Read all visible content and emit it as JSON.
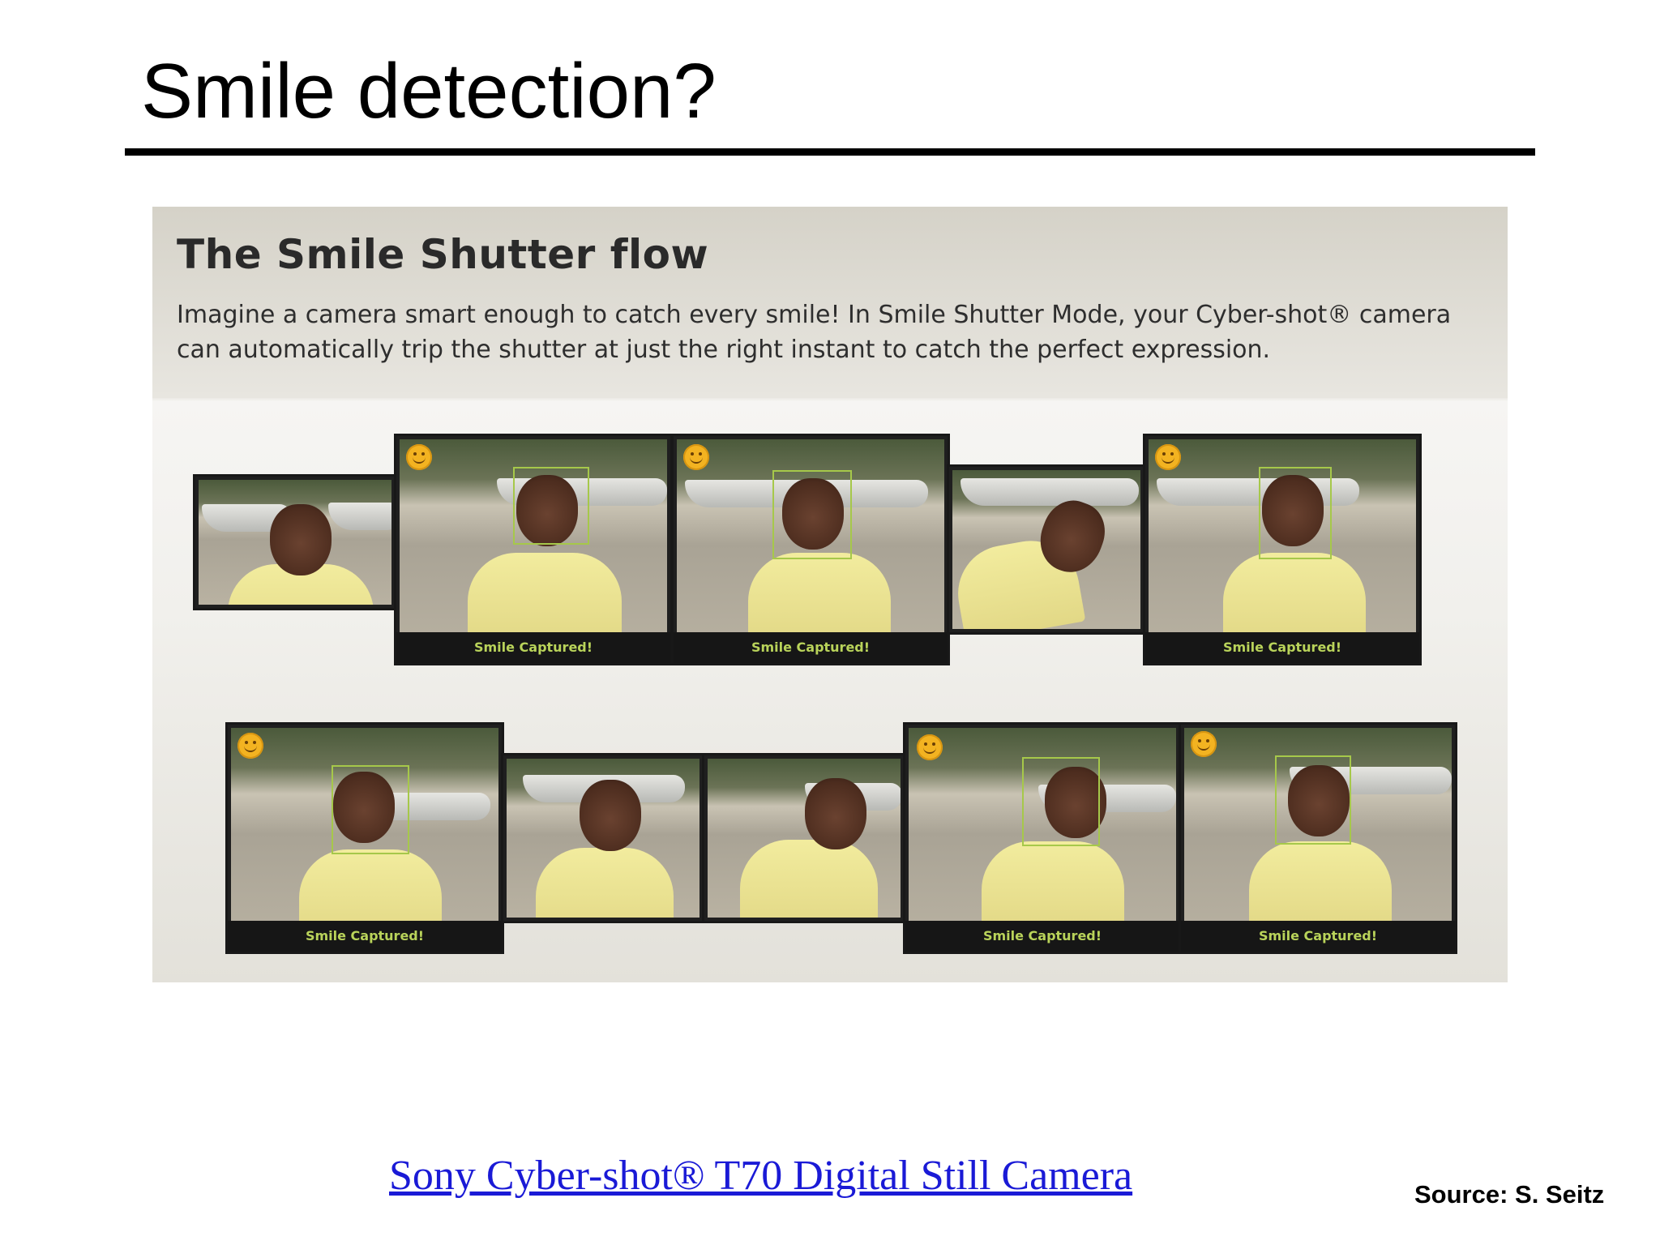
{
  "slide": {
    "title": "Smile detection?",
    "source_link": "Sony Cyber-shot® T70 Digital Still Camera ",
    "source_credit": "Source: S. Seitz"
  },
  "panel": {
    "title": "The Smile Shutter flow",
    "description": "Imagine a camera smart enough to catch every smile! In Smile Shutter Mode, your Cyber-shot® camera can automatically trip the shutter at just the right instant to catch the perfect expression."
  },
  "frames": {
    "caption": "Smile Captured!"
  },
  "colors": {
    "link": "#1a1ad6",
    "focus_box": "#a6c84a",
    "caption_text": "#b9d35a",
    "smile_icon": "#f3b321"
  },
  "icons": {
    "smile": "smiley-face-icon"
  }
}
